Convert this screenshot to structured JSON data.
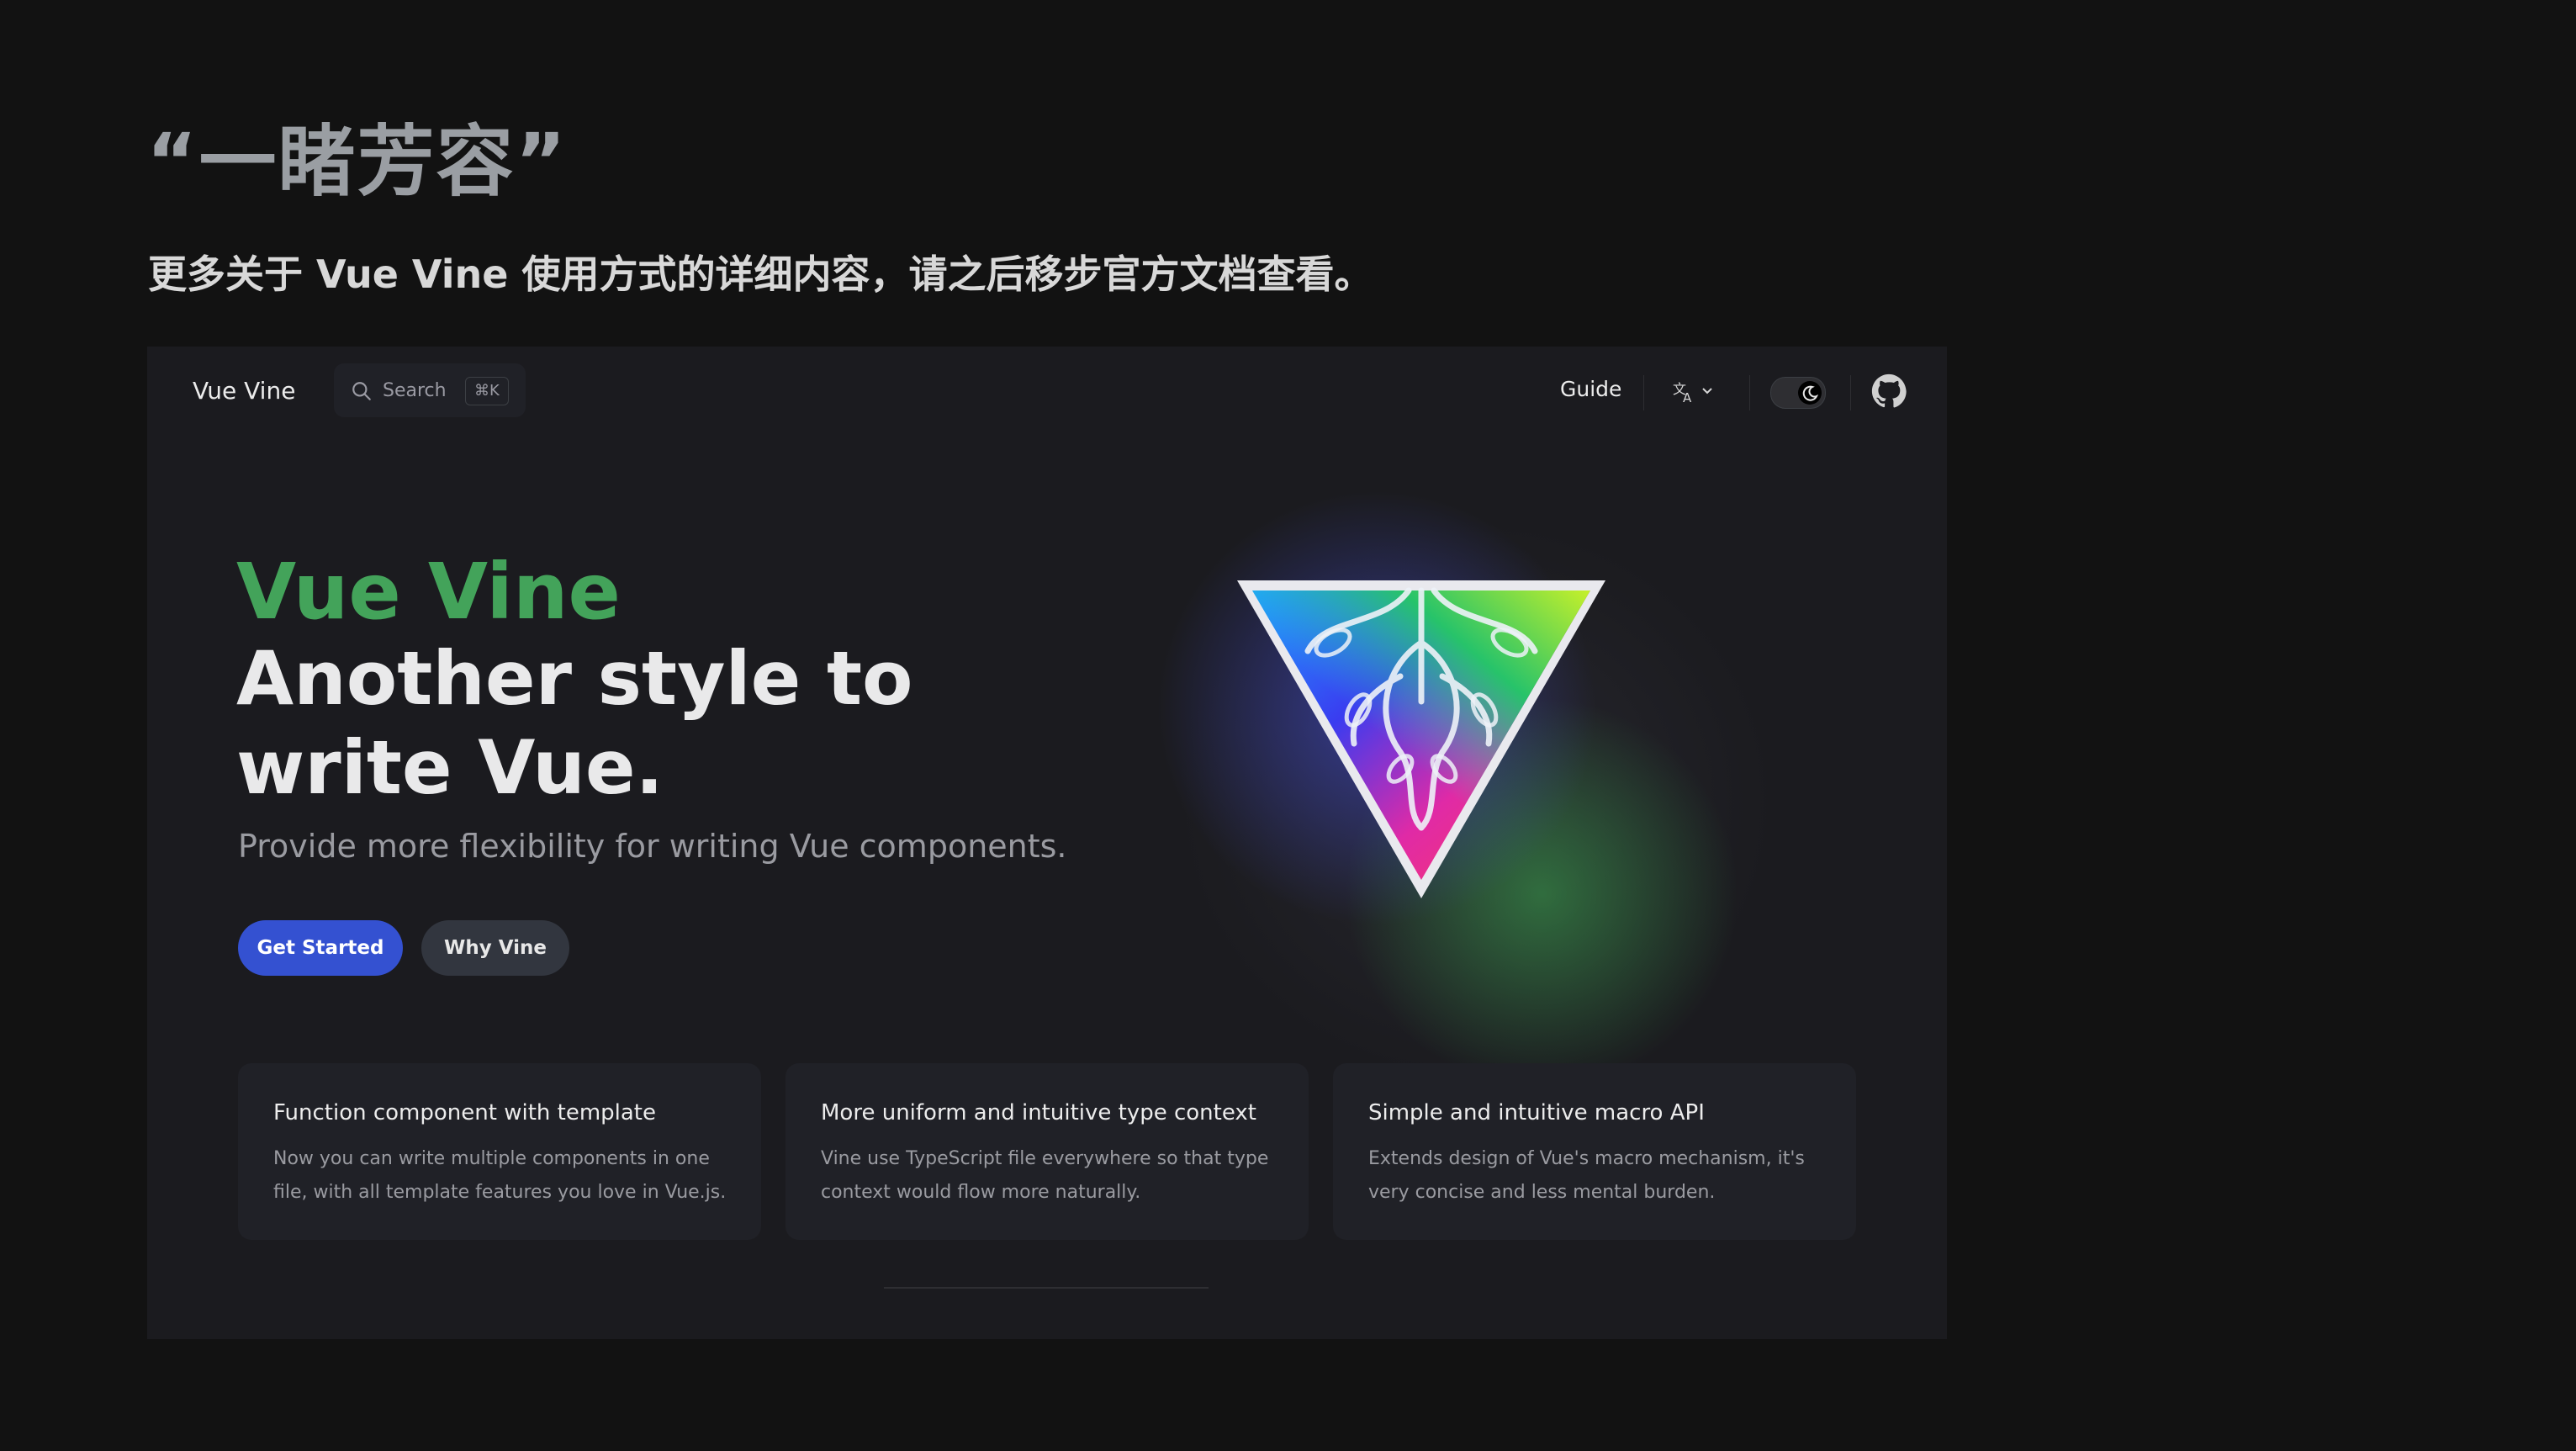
{
  "slide": {
    "title": "“一睹芳容”",
    "subtitle": "更多关于 Vue Vine 使用方式的详细内容，请之后移步官方文档查看。"
  },
  "navbar": {
    "brand": "Vue Vine",
    "search_label": "Search",
    "search_shortcut": "⌘K",
    "guide": "Guide",
    "icons": [
      "search-icon",
      "translate-icon",
      "chevron-down-icon",
      "moon-icon",
      "github-icon"
    ]
  },
  "hero": {
    "name": "Vue Vine",
    "text": "Another style to write Vue.",
    "tagline": "Provide more flexibility for writing Vue components.",
    "primary_action": "Get Started",
    "secondary_action": "Why Vine"
  },
  "features": [
    {
      "title": "Function component with template",
      "details": "Now you can write multiple components in one file, with all template features you love in Vue.js."
    },
    {
      "title": "More uniform and intuitive type context",
      "details": "Vine use TypeScript file everywhere so that type context would flow more naturally."
    },
    {
      "title": "Simple and intuitive macro API",
      "details": "Extends design of Vue's macro mechanism, it's very concise and less mental burden."
    }
  ],
  "colors": {
    "background": "#121212",
    "window": "#1b1b1f",
    "brand_green": "#43a35a",
    "primary_button": "#3451d1"
  }
}
